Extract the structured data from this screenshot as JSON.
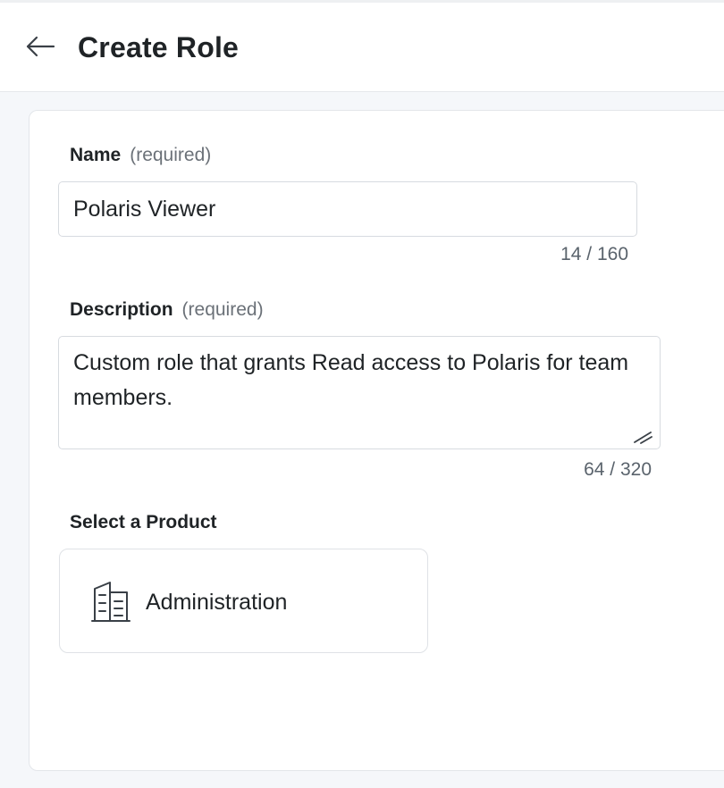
{
  "header": {
    "back_icon": "arrow-left-icon",
    "title": "Create Role"
  },
  "form": {
    "name": {
      "label": "Name",
      "required_hint": "(required)",
      "value": "Polaris Viewer",
      "counter": "14 / 160"
    },
    "description": {
      "label": "Description",
      "required_hint": "(required)",
      "value": "Custom role that grants Read access to Polaris for team members.",
      "counter": "64 / 320"
    },
    "product": {
      "label": "Select a Product",
      "options": [
        {
          "label": "Administration",
          "icon": "building-icon"
        }
      ]
    }
  }
}
